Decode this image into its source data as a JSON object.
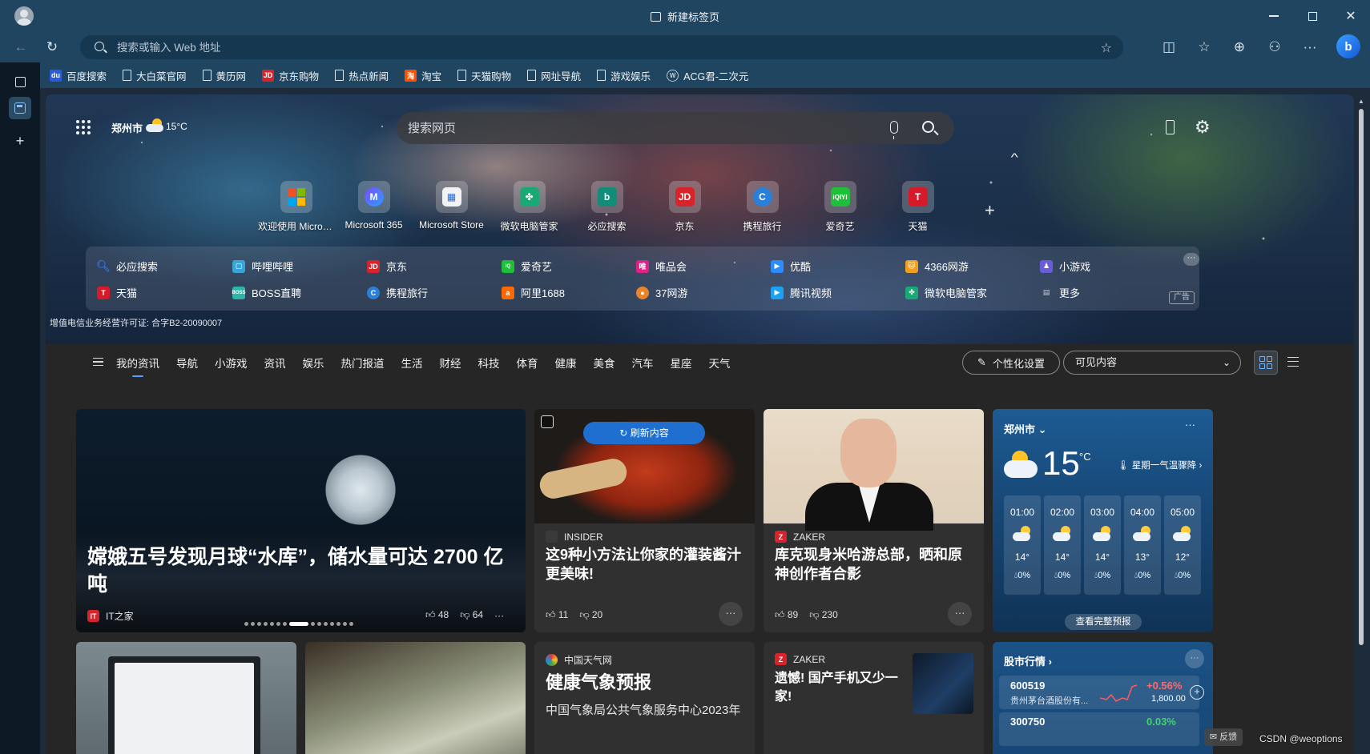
{
  "window": {
    "title": "新建标签页"
  },
  "address_bar": {
    "placeholder": "搜索或输入 Web 地址"
  },
  "bookmarks": [
    {
      "label": "百度搜索",
      "icon": "baidu-icon"
    },
    {
      "label": "大白菜官网",
      "icon": "page-icon"
    },
    {
      "label": "黄历网",
      "icon": "page-icon"
    },
    {
      "label": "京东购物",
      "icon": "jd-icon"
    },
    {
      "label": "热点新闻",
      "icon": "page-icon"
    },
    {
      "label": "淘宝",
      "icon": "taobao-icon"
    },
    {
      "label": "天猫购物",
      "icon": "page-icon"
    },
    {
      "label": "网址导航",
      "icon": "page-icon"
    },
    {
      "label": "游戏娱乐",
      "icon": "page-icon"
    },
    {
      "label": "ACG君-二次元",
      "icon": "w-icon"
    }
  ],
  "header": {
    "city": "郑州市",
    "temp": "15°C"
  },
  "search": {
    "placeholder": "搜索网页"
  },
  "top_sites": [
    {
      "label": "欢迎使用 Microsoft Edge",
      "icon": "microsoft-logo-icon"
    },
    {
      "label": "Microsoft 365",
      "icon": "m365-icon"
    },
    {
      "label": "Microsoft Store",
      "icon": "store-icon"
    },
    {
      "label": "微软电脑管家",
      "icon": "pc-manager-icon"
    },
    {
      "label": "必应搜索",
      "icon": "bing-icon"
    },
    {
      "label": "京东",
      "icon": "jd-icon"
    },
    {
      "label": "携程旅行",
      "icon": "ctrip-icon"
    },
    {
      "label": "爱奇艺",
      "icon": "iqiyi-icon"
    },
    {
      "label": "天猫",
      "icon": "tmall-icon"
    }
  ],
  "quick_links": [
    {
      "label": "必应搜索",
      "color": "#2b6ed6"
    },
    {
      "label": "哔哩哔哩",
      "color": "#3aa4d8"
    },
    {
      "label": "京东",
      "color": "#d8232a"
    },
    {
      "label": "爱奇艺",
      "color": "#1fbf3a"
    },
    {
      "label": "唯品会",
      "color": "#e0218a"
    },
    {
      "label": "优酷",
      "color": "#2a8cff"
    },
    {
      "label": "4366网游",
      "color": "#f0a020"
    },
    {
      "label": "小游戏",
      "color": "#6a5bd8"
    },
    {
      "label": "天猫",
      "color": "#d61a2a"
    },
    {
      "label": "BOSS直聘",
      "color": "#2bb6a6"
    },
    {
      "label": "携程旅行",
      "color": "#2a7fd8"
    },
    {
      "label": "阿里1688",
      "color": "#ff6a00"
    },
    {
      "label": "37网游",
      "color": "#e8842a"
    },
    {
      "label": "腾讯视频",
      "color": "#1da1f2"
    },
    {
      "label": "微软电脑管家",
      "color": "#19a974"
    },
    {
      "label": "更多",
      "color": "#888888"
    }
  ],
  "ad_tag": "广告",
  "license": "增值电信业务经营许可证: 合字B2-20090007",
  "feed_tabs": [
    "我的资讯",
    "导航",
    "小游戏",
    "资讯",
    "娱乐",
    "热门报道",
    "生活",
    "财经",
    "科技",
    "体育",
    "健康",
    "美食",
    "汽车",
    "星座",
    "天气"
  ],
  "personalize_label": "个性化设置",
  "visible_label": "可见内容",
  "hero_story": {
    "headline": "嫦娥五号发现月球“水库”，储水量可达 2700 亿吨",
    "source": "IT之家",
    "likes": "48",
    "dislikes": "64"
  },
  "refresh_label": "刷新内容",
  "card_a": {
    "source": "INSIDER",
    "title": "这9种小方法让你家的灌装酱汁更美味!",
    "likes": "11",
    "dislikes": "20"
  },
  "card_b": {
    "source": "ZAKER",
    "title": "库克现身米哈游总部，晒和原神创作者合影",
    "likes": "89",
    "dislikes": "230"
  },
  "weather": {
    "city": "郑州市",
    "temp": "15",
    "unit": "°C",
    "alert": "星期一气温骤降",
    "hours": [
      {
        "time": "01:00",
        "temp": "14°",
        "precip": "0%"
      },
      {
        "time": "02:00",
        "temp": "14°",
        "precip": "0%"
      },
      {
        "time": "03:00",
        "temp": "14°",
        "precip": "0%"
      },
      {
        "time": "04:00",
        "temp": "13°",
        "precip": "0%"
      },
      {
        "time": "05:00",
        "temp": "12°",
        "precip": "0%"
      }
    ],
    "full_forecast": "查看完整预报"
  },
  "card_c": {
    "source": "中国天气网",
    "title": "健康气象预报",
    "snippet": "中国气象局公共气象服务中心2023年"
  },
  "card_d": {
    "source": "ZAKER",
    "title": "遗憾! 国产手机又少一家!"
  },
  "stocks": {
    "title": "股市行情",
    "rows": [
      {
        "code": "600519",
        "name": "贵州茅台酒股份有...",
        "change": "+0.56%",
        "price": "1,800.00"
      },
      {
        "code": "300750",
        "change": "0.03%"
      }
    ]
  },
  "feedback_label": "反馈",
  "watermark": "CSDN @weoptions"
}
